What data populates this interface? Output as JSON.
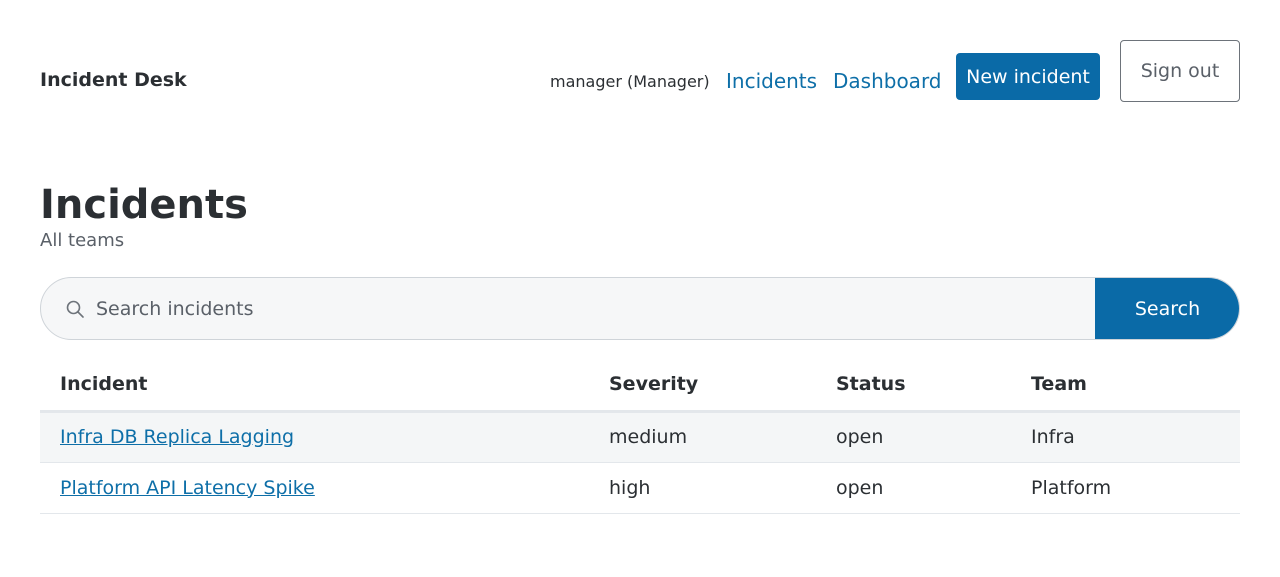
{
  "header": {
    "brand": "Incident Desk",
    "user": "manager (Manager)",
    "nav": {
      "incidents": "Incidents",
      "dashboard": "Dashboard"
    },
    "new_incident_label": "New incident",
    "sign_out_label": "Sign out"
  },
  "main": {
    "title": "Incidents",
    "subtitle": "All teams",
    "search": {
      "placeholder": "Search incidents",
      "value": "",
      "button_label": "Search"
    },
    "table": {
      "columns": [
        "Incident",
        "Severity",
        "Status",
        "Team"
      ],
      "rows": [
        {
          "incident": "Infra DB Replica Lagging",
          "severity": "medium",
          "status": "open",
          "team": "Infra"
        },
        {
          "incident": "Platform API Latency Spike",
          "severity": "high",
          "status": "open",
          "team": "Platform"
        }
      ]
    }
  },
  "icons": {
    "search": "search-icon"
  },
  "colors": {
    "accent": "#0a6aa7",
    "link": "#0e6fa8",
    "text": "#2b2f33",
    "muted": "#5a6068"
  }
}
